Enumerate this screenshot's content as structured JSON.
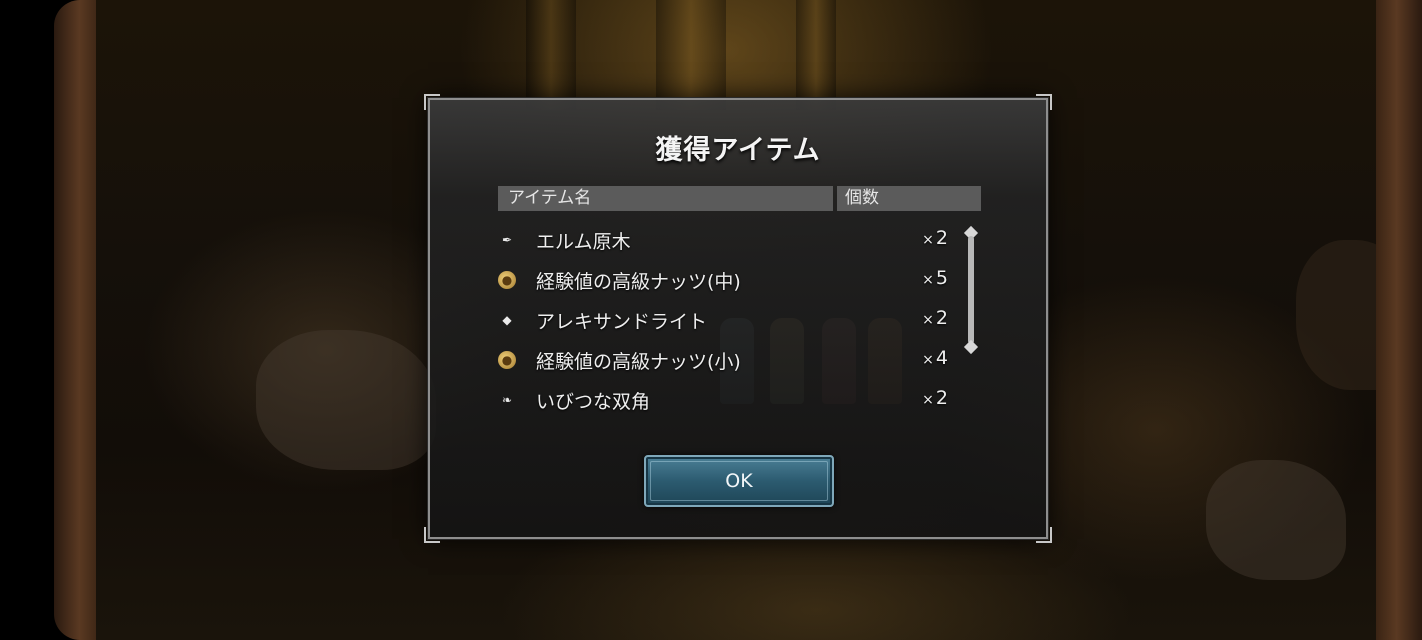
{
  "dialog": {
    "title": "獲得アイテム",
    "header": {
      "name_label": "アイテム名",
      "count_label": "個数"
    },
    "items": [
      {
        "icon": "log-icon",
        "name": "エルム原木",
        "qty": "2"
      },
      {
        "icon": "nut-icon",
        "name": "経験値の高級ナッツ(中)",
        "qty": "5"
      },
      {
        "icon": "stone-icon",
        "name": "アレキサンドライト",
        "qty": "2"
      },
      {
        "icon": "nut-icon",
        "name": "経験値の高級ナッツ(小)",
        "qty": "4"
      },
      {
        "icon": "horn-icon",
        "name": "いびつな双角",
        "qty": "2"
      }
    ],
    "quantity_prefix": "×",
    "ok_label": "OK"
  },
  "colors": {
    "button_accent": "#2c5b70",
    "header_bg": "#5b5b5b",
    "frame_wood": "#5a3922"
  }
}
